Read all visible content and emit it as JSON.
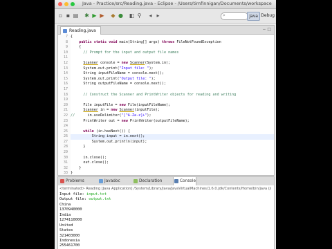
{
  "window": {
    "title": "Java - Practice/src/Reading.java - Eclipse - /Users/timfinnigan/Documents/workspace"
  },
  "toolbar": {
    "icons": [
      "new-icon",
      "save-icon",
      "print-icon",
      "debug-icon",
      "run-icon",
      "external-tools-icon",
      "new-package-icon",
      "new-class-icon",
      "open-type-icon",
      "search-icon",
      "back-icon",
      "forward-icon"
    ],
    "search_glyph": "⌕",
    "perspectives": {
      "java": "Java",
      "debug": "Debug"
    }
  },
  "editor": {
    "tab_label": "Reading.java",
    "close_glyph": "− □",
    "lines": [
      {
        "n": "7",
        "html": "{"
      },
      {
        "n": "8",
        "html": "    <span class=\"kw\">public static void</span> main(String[] args) <span class=\"kw\">throws</span> FileNotFoundException"
      },
      {
        "n": "9",
        "html": "    {"
      },
      {
        "n": "10",
        "html": "      <span class=\"cm\">// Prompt for the input and output file names</span>"
      },
      {
        "n": "11",
        "html": ""
      },
      {
        "n": "12",
        "html": "      <span class=\"ty\">Scanner</span> console = <span class=\"kw\">new</span> <span class=\"ty\">Scanner</span>(System.in);"
      },
      {
        "n": "13",
        "html": "      System.out.print(<span class=\"st\">\"Input file: \"</span>);"
      },
      {
        "n": "14",
        "html": "      String inputFileName = console.next();"
      },
      {
        "n": "15",
        "html": "      System.out.print(<span class=\"st\">\"Output file: \"</span>);"
      },
      {
        "n": "16",
        "html": "      String outputFileName = console.next();"
      },
      {
        "n": "17",
        "html": ""
      },
      {
        "n": "18",
        "html": "      <span class=\"cm\">// Construct the Scanner and PrintWriter objects for reading and writing</span>"
      },
      {
        "n": "19",
        "html": ""
      },
      {
        "n": "20",
        "html": "      File inputFile = <span class=\"kw\">new</span> File(inputFileName);"
      },
      {
        "n": "21",
        "html": "      <span class=\"ty\">Scanner</span> in = <span class=\"kw\">new</span> <span class=\"ty\">Scanner</span>(inputFile);"
      },
      {
        "n": "22",
        "html": "<span class=\"cm\">//</span>      in.useDelimiter(<span class=\"st\">\"[^A-Za-z]+\"</span>);"
      },
      {
        "n": "23",
        "html": "      PrintWriter out = <span class=\"kw\">new</span> PrintWriter(outputFileName);"
      },
      {
        "n": "24",
        "html": ""
      },
      {
        "n": "25",
        "html": "      <span class=\"kw\">while</span> (in.hasNext()) {"
      },
      {
        "n": "26",
        "html": "          String input = in.next();"
      },
      {
        "n": "27",
        "html": "          System.out.println(input);"
      },
      {
        "n": "28",
        "html": "      }"
      },
      {
        "n": "29",
        "html": ""
      },
      {
        "n": "30",
        "html": "      in.close();"
      },
      {
        "n": "31",
        "html": "      out.close();"
      },
      {
        "n": "32",
        "html": "    }"
      },
      {
        "n": "33",
        "html": "}"
      },
      {
        "n": "34",
        "html": ""
      }
    ],
    "highlight_line": 26
  },
  "views": {
    "tabs": [
      {
        "label": "Problems",
        "color": "#d9534f"
      },
      {
        "label": "Javadoc",
        "color": "#6a9fd8"
      },
      {
        "label": "Declaration",
        "color": "#8fbf5f"
      },
      {
        "label": "Console",
        "color": "#5a7fb0"
      }
    ],
    "active": 3
  },
  "console": {
    "header": "<terminated> Reading [Java Application] /System/Library/Java/JavaVirtualMachines/1.6.0.jdk/Contents/Home/bin/java (Jul 1",
    "lines": [
      {
        "text": "Input file: ",
        "input": "input.txt"
      },
      {
        "text": "Output file: ",
        "input": "output.txt"
      },
      {
        "text": "China",
        "input": ""
      },
      {
        "text": "1370940000",
        "input": ""
      },
      {
        "text": "India",
        "input": ""
      },
      {
        "text": "1274110000",
        "input": ""
      },
      {
        "text": "United",
        "input": ""
      },
      {
        "text": "States",
        "input": ""
      },
      {
        "text": "321403000",
        "input": ""
      },
      {
        "text": "Indonesia",
        "input": ""
      },
      {
        "text": "255461700",
        "input": ""
      }
    ]
  }
}
